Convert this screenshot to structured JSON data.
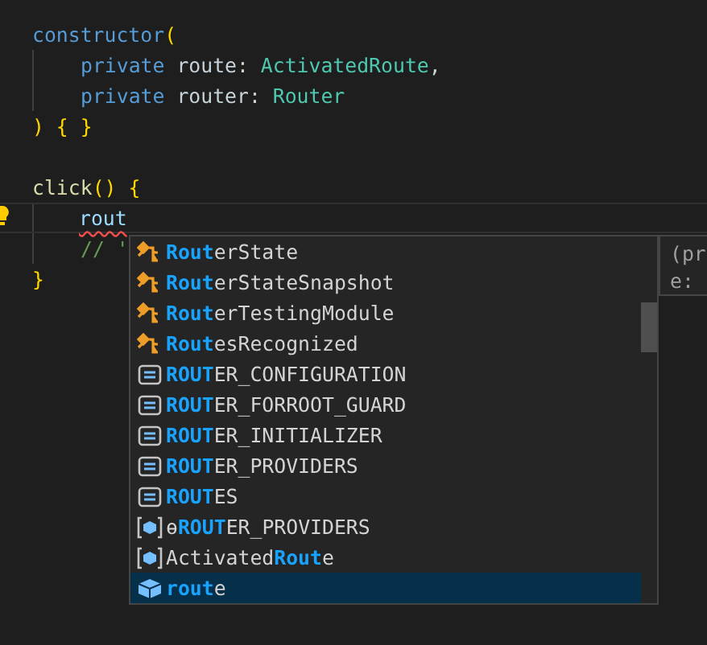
{
  "editor": {
    "blocks": [
      {
        "open": [
          {
            "text": "constructor",
            "kind": "keyword"
          },
          {
            "text": "(",
            "kind": "bracket"
          }
        ],
        "body": [
          {
            "current": false,
            "tokens": [
              {
                "text": "private ",
                "kind": "keyword"
              },
              {
                "text": "route",
                "kind": "param"
              },
              {
                "text": ": ",
                "kind": "plain"
              },
              {
                "text": "ActivatedRoute",
                "kind": "type"
              },
              {
                "text": ",",
                "kind": "plain"
              }
            ]
          },
          {
            "current": false,
            "tokens": [
              {
                "text": "private ",
                "kind": "keyword"
              },
              {
                "text": "router",
                "kind": "param"
              },
              {
                "text": ": ",
                "kind": "plain"
              },
              {
                "text": "Router",
                "kind": "type"
              }
            ]
          }
        ],
        "close": [
          {
            "text": ") { }",
            "kind": "bracket"
          }
        ]
      },
      {
        "open": [
          {
            "text": "click",
            "kind": "function"
          },
          {
            "text": "() {",
            "kind": "bracket"
          }
        ],
        "body": [
          {
            "current": true,
            "tokens": [
              {
                "text": "rout",
                "kind": "error"
              }
            ]
          },
          {
            "current": false,
            "tokens": [
              {
                "text": "// '",
                "kind": "comment"
              }
            ]
          }
        ],
        "close": [
          {
            "text": "}",
            "kind": "bracket"
          }
        ]
      }
    ]
  },
  "suggestions": [
    {
      "kind": "class",
      "match": "Rout",
      "post": "erState",
      "selected": false
    },
    {
      "kind": "class",
      "match": "Rout",
      "post": "erStateSnapshot",
      "selected": false
    },
    {
      "kind": "class",
      "match": "Rout",
      "post": "erTestingModule",
      "selected": false
    },
    {
      "kind": "class",
      "match": "Rout",
      "post": "esRecognized",
      "selected": false
    },
    {
      "kind": "constant",
      "match": "ROUT",
      "post": "ER_CONFIGURATION",
      "selected": false
    },
    {
      "kind": "constant",
      "match": "ROUT",
      "post": "ER_FORROOT_GUARD",
      "selected": false
    },
    {
      "kind": "constant",
      "match": "ROUT",
      "post": "ER_INITIALIZER",
      "selected": false
    },
    {
      "kind": "constant",
      "match": "ROUT",
      "post": "ER_PROVIDERS",
      "selected": false
    },
    {
      "kind": "constant",
      "match": "ROUT",
      "post": "ES",
      "selected": false
    },
    {
      "kind": "module",
      "pre": "ɵ",
      "match": "ROUT",
      "post": "ER_PROVIDERS",
      "selected": false
    },
    {
      "kind": "module",
      "pre": "Activated",
      "match": "Rout",
      "post": "e",
      "selected": false
    },
    {
      "kind": "variable",
      "match": "rout",
      "post": "e",
      "selected": true
    }
  ],
  "details": [
    "(pr",
    "e:"
  ]
}
